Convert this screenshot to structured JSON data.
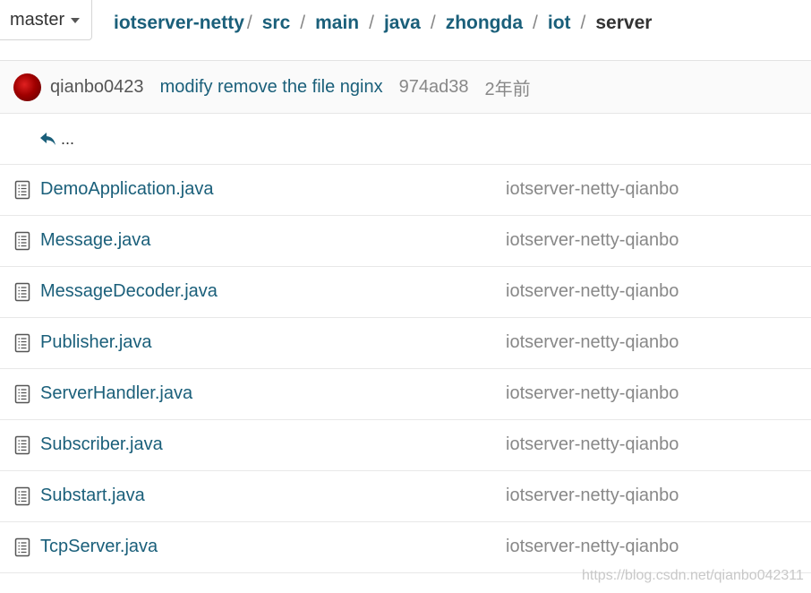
{
  "branch": {
    "label": "master"
  },
  "breadcrumb": {
    "repo": "iotserver-netty",
    "segments": [
      "src",
      "main",
      "java",
      "zhongda",
      "iot"
    ],
    "current": "server",
    "separator": "/"
  },
  "commit": {
    "author": "qianbo0423",
    "message": "modify remove the file nginx",
    "sha": "974ad38",
    "time": "2年前"
  },
  "parent_dir": {
    "label": "..."
  },
  "files": [
    {
      "name": "DemoApplication.java",
      "last_commit": "iotserver-netty-qianbo"
    },
    {
      "name": "Message.java",
      "last_commit": "iotserver-netty-qianbo"
    },
    {
      "name": "MessageDecoder.java",
      "last_commit": "iotserver-netty-qianbo"
    },
    {
      "name": "Publisher.java",
      "last_commit": "iotserver-netty-qianbo"
    },
    {
      "name": "ServerHandler.java",
      "last_commit": "iotserver-netty-qianbo"
    },
    {
      "name": "Subscriber.java",
      "last_commit": "iotserver-netty-qianbo"
    },
    {
      "name": "Substart.java",
      "last_commit": "iotserver-netty-qianbo"
    },
    {
      "name": "TcpServer.java",
      "last_commit": "iotserver-netty-qianbo"
    }
  ],
  "watermark": "https://blog.csdn.net/qianbo042311",
  "colors": {
    "link": "#1a5f7a",
    "muted": "#888888",
    "avatar": "#b00000"
  },
  "icons": {
    "branch_caret": "caret-down-icon",
    "parent": "back-arrow-icon",
    "file": "file-text-icon"
  }
}
